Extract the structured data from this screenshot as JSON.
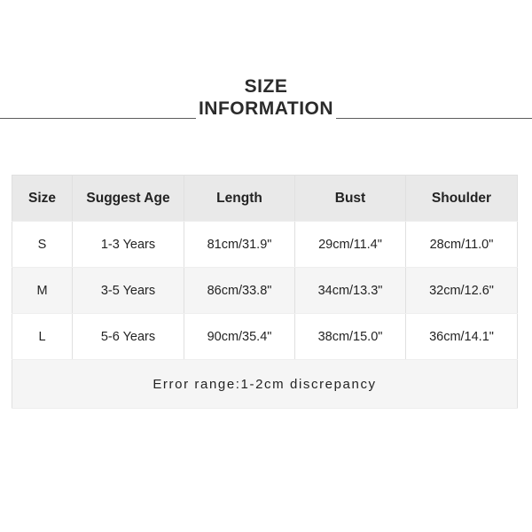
{
  "title": {
    "line1": "SIZE",
    "line2": "INFORMATION"
  },
  "table": {
    "columns": [
      "Size",
      "Suggest Age",
      "Length",
      "Bust",
      "Shoulder"
    ],
    "rows": [
      {
        "size": "S",
        "suggest_age": "1-3 Years",
        "length": "81cm/31.9\"",
        "bust": "29cm/11.4\"",
        "shoulder": "28cm/11.0\""
      },
      {
        "size": "M",
        "suggest_age": "3-5 Years",
        "length": "86cm/33.8\"",
        "bust": "34cm/13.3\"",
        "shoulder": "32cm/12.6\""
      },
      {
        "size": "L",
        "suggest_age": "5-6 Years",
        "length": "90cm/35.4\"",
        "bust": "38cm/15.0\"",
        "shoulder": "36cm/14.1\""
      }
    ],
    "footer_note": "Error range:1-2cm discrepancy"
  },
  "colors": {
    "page_background": "#ffffff",
    "header_background": "#e9e9e9",
    "stripe_background": "#f5f5f5",
    "footer_background": "#f5f5f5",
    "border": "#e0e0e0",
    "text": "#232323",
    "title_text": "#2b2b2b",
    "rule": "#5c5c5c"
  }
}
